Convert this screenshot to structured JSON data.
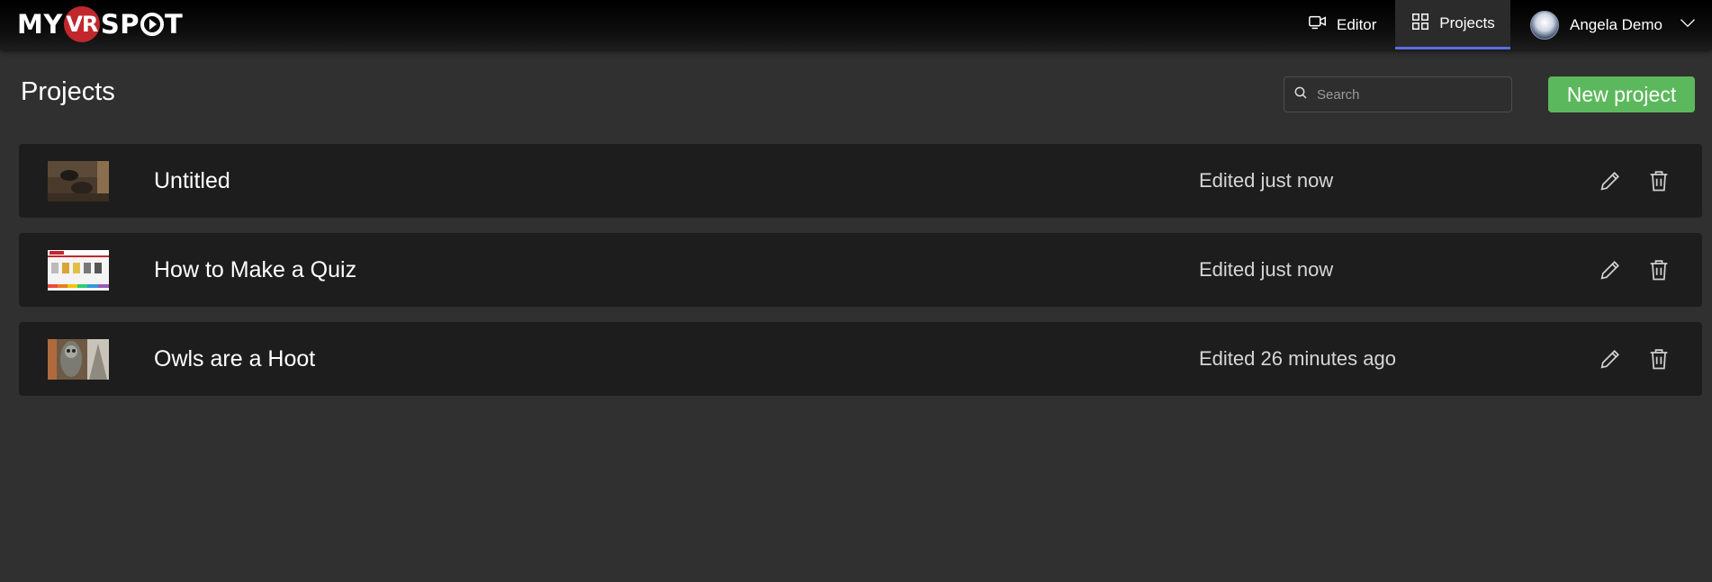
{
  "header": {
    "logo": {
      "prefix": "MY",
      "badge": "VR",
      "suffix_s": "SP",
      "suffix_t": "T"
    },
    "nav": {
      "editor_label": "Editor",
      "editor_icon": "camera-video-icon",
      "projects_label": "Projects",
      "projects_icon": "grid-icon",
      "user_name": "Angela Demo",
      "user_menu_icon": "chevron-down-icon"
    },
    "accent_color": "#5b6ee1"
  },
  "main": {
    "title": "Projects",
    "search": {
      "placeholder": "Search",
      "value": ""
    },
    "new_project_label": "New project",
    "new_project_color": "#5cb85c"
  },
  "projects": [
    {
      "name": "Untitled",
      "edited": "Edited just now"
    },
    {
      "name": "How to Make a Quiz",
      "edited": "Edited just now"
    },
    {
      "name": "Owls are a Hoot",
      "edited": "Edited 26 minutes ago"
    }
  ]
}
